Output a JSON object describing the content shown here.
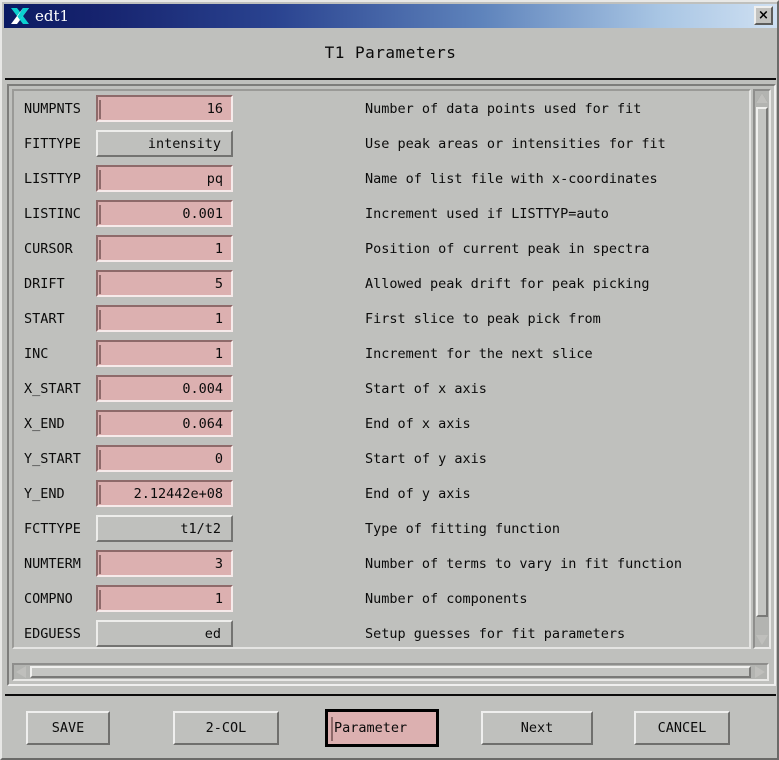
{
  "window": {
    "app_icon": "x11-logo-icon",
    "title": "edt1",
    "close_label": "×"
  },
  "header": {
    "title": "T1 Parameters"
  },
  "parameters": [
    {
      "label": "NUMPNTS",
      "value": "16",
      "kind": "text",
      "description": "Number of data points used for fit"
    },
    {
      "label": "FITTYPE",
      "value": "intensity",
      "kind": "option",
      "description": "Use peak areas or intensities for fit"
    },
    {
      "label": "LISTTYP",
      "value": "pq",
      "kind": "text",
      "description": "Name of list file with x-coordinates"
    },
    {
      "label": "LISTINC",
      "value": "0.001",
      "kind": "text",
      "description": "Increment used if LISTTYP=auto"
    },
    {
      "label": "CURSOR",
      "value": "1",
      "kind": "text",
      "description": "Position of current peak in spectra"
    },
    {
      "label": "DRIFT",
      "value": "5",
      "kind": "text",
      "description": "Allowed peak drift for peak picking"
    },
    {
      "label": "START",
      "value": "1",
      "kind": "text",
      "description": "First slice to peak pick from"
    },
    {
      "label": "INC",
      "value": "1",
      "kind": "text",
      "description": "Increment for the next slice"
    },
    {
      "label": "X_START",
      "value": "0.004",
      "kind": "text",
      "description": "Start of x axis"
    },
    {
      "label": "X_END",
      "value": "0.064",
      "kind": "text",
      "description": "End of x axis"
    },
    {
      "label": "Y_START",
      "value": "0",
      "kind": "text",
      "description": "Start of y axis"
    },
    {
      "label": "Y_END",
      "value": "2.12442e+08",
      "kind": "text",
      "description": "End of y axis"
    },
    {
      "label": "FCTTYPE",
      "value": "t1/t2",
      "kind": "option",
      "description": "Type of fitting function"
    },
    {
      "label": "NUMTERM",
      "value": "3",
      "kind": "text",
      "description": "Number of terms to vary in fit function"
    },
    {
      "label": "COMPNO",
      "value": "1",
      "kind": "text",
      "description": "Number of components"
    },
    {
      "label": "EDGUESS",
      "value": "ed",
      "kind": "option",
      "description": "Setup guesses for fit parameters"
    }
  ],
  "buttons": {
    "save": "SAVE",
    "two_col": "2-COL",
    "parameter_value": "Parameter",
    "next": "Next",
    "cancel": "CANCEL"
  },
  "colors": {
    "field_pink": "#dcb0b0",
    "window_gray": "#bfc0bd",
    "titlebar_dark_blue": "#0b1b63",
    "titlebar_light_blue": "#cfe0f2",
    "text": "#0b0b0b"
  }
}
